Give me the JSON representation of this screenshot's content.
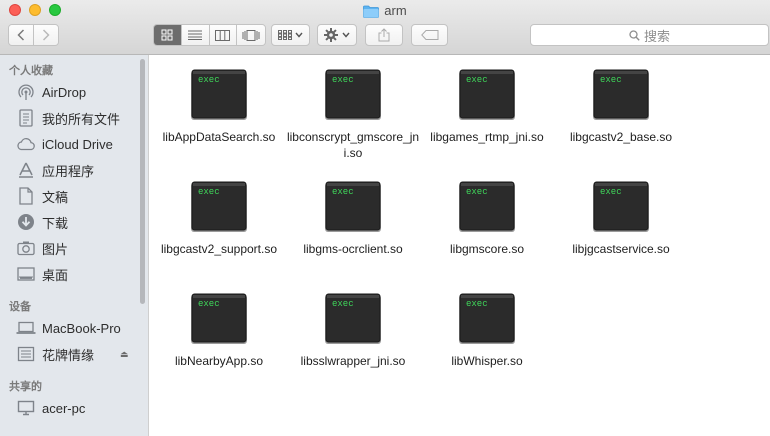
{
  "window": {
    "title": "arm"
  },
  "toolbar": {
    "back_icon": "chevron-left-icon",
    "forward_icon": "chevron-right-icon",
    "view_modes": [
      "icon-view-icon",
      "list-view-icon",
      "column-view-icon",
      "cover-flow-icon"
    ],
    "arrange_icon": "arrange-grid-icon",
    "action_icon": "gear-icon",
    "share_icon": "share-icon",
    "tag_icon": "tag-icon",
    "search_placeholder": "搜索"
  },
  "sidebar": {
    "favorites_header": "个人收藏",
    "favorites": [
      {
        "label": "AirDrop",
        "icon": "airdrop-icon"
      },
      {
        "label": "我的所有文件",
        "icon": "all-files-icon"
      },
      {
        "label": "iCloud Drive",
        "icon": "cloud-icon"
      },
      {
        "label": "应用程序",
        "icon": "applications-icon"
      },
      {
        "label": "文稿",
        "icon": "document-icon"
      },
      {
        "label": "下载",
        "icon": "download-icon"
      },
      {
        "label": "图片",
        "icon": "camera-icon"
      },
      {
        "label": "桌面",
        "icon": "desktop-icon"
      }
    ],
    "devices_header": "设备",
    "devices": [
      {
        "label": "MacBook-Pro",
        "icon": "laptop-icon"
      },
      {
        "label": "花牌情缘",
        "icon": "disk-icon",
        "eject": "⏏"
      }
    ],
    "shared_header": "共享的",
    "shared": [
      {
        "label": "acer-pc",
        "icon": "monitor-icon"
      }
    ]
  },
  "files": [
    {
      "name": "libAppDataSearch.so",
      "icon_label": "exec"
    },
    {
      "name": "libconscrypt_gmscore_jni.so",
      "icon_label": "exec"
    },
    {
      "name": "libgames_rtmp_jni.so",
      "icon_label": "exec"
    },
    {
      "name": "libgcastv2_base.so",
      "icon_label": "exec"
    },
    {
      "name": "libgcastv2_support.so",
      "icon_label": "exec"
    },
    {
      "name": "libgms-ocrclient.so",
      "icon_label": "exec"
    },
    {
      "name": "libgmscore.so",
      "icon_label": "exec"
    },
    {
      "name": "libjgcastservice.so",
      "icon_label": "exec"
    },
    {
      "name": "libNearbyApp.so",
      "icon_label": "exec"
    },
    {
      "name": "libsslwrapper_jni.so",
      "icon_label": "exec"
    },
    {
      "name": "libWhisper.so",
      "icon_label": "exec"
    }
  ]
}
